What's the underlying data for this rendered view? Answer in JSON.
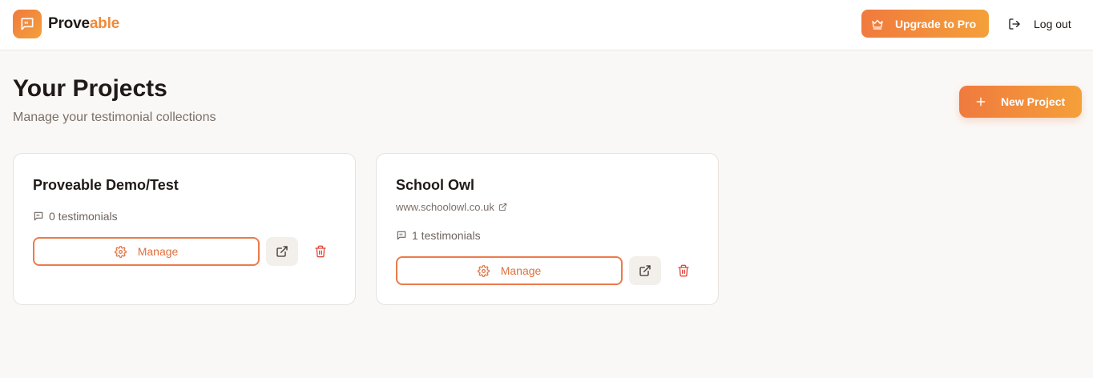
{
  "brand": {
    "part1": "Prove",
    "part2": "able",
    "logo_icon": "message-quote-icon"
  },
  "header": {
    "upgrade_label": "Upgrade to Pro",
    "upgrade_icon": "crown-icon",
    "logout_label": "Log out",
    "logout_icon": "logout-icon"
  },
  "page": {
    "title": "Your Projects",
    "subtitle": "Manage your testimonial collections",
    "new_project_label": "New Project",
    "new_project_icon": "plus-icon"
  },
  "projects": [
    {
      "name": "Proveable Demo/Test",
      "url": "",
      "testimonials": "0 testimonials",
      "manage_label": "Manage"
    },
    {
      "name": "School Owl",
      "url": "www.schoolowl.co.uk",
      "testimonials": "1 testimonials",
      "manage_label": "Manage"
    }
  ],
  "colors": {
    "accent": "#f07a3e",
    "accent_end": "#f4a03a",
    "danger": "#e0473a",
    "background": "#faf8f6"
  }
}
